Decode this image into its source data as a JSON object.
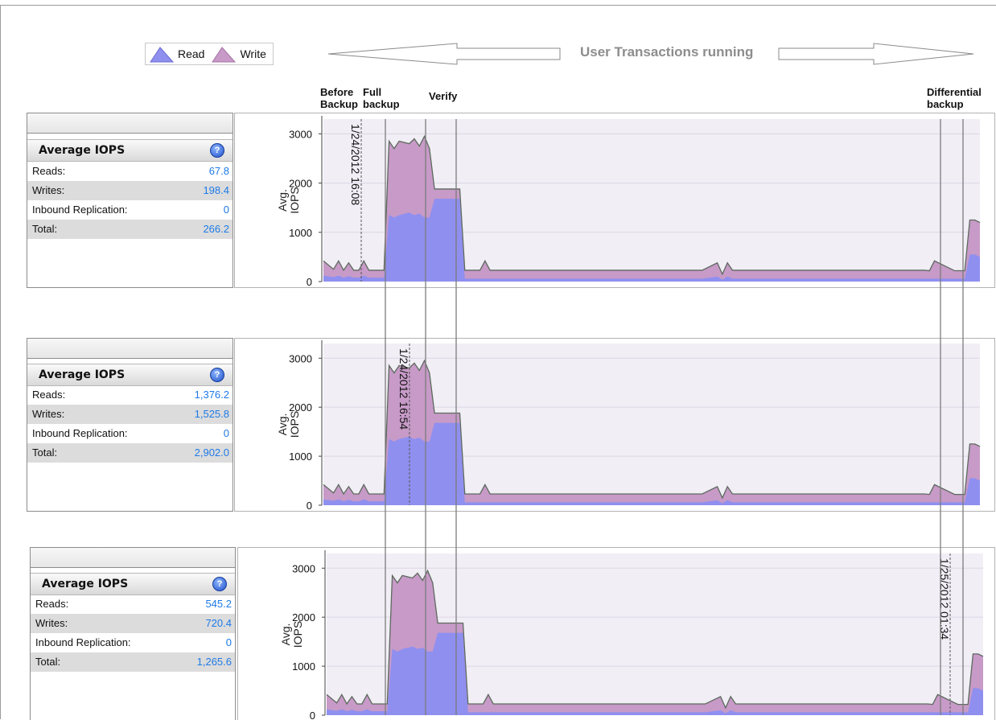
{
  "legend": {
    "items": [
      {
        "label": "Read",
        "color": "#8f8ff0"
      },
      {
        "label": "Write",
        "color": "#c79ac7"
      }
    ]
  },
  "banner": {
    "text": "User Transactions running"
  },
  "phases": [
    {
      "id": "before",
      "label": "Before\nBackup"
    },
    {
      "id": "full",
      "label": "Full\nbackup"
    },
    {
      "id": "verify",
      "label": "Verify"
    },
    {
      "id": "diff",
      "label": "Differential\nbackup"
    }
  ],
  "panels": [
    {
      "title": "Average IOPS",
      "rows": [
        {
          "label": "Reads:",
          "value": "67.8"
        },
        {
          "label": "Writes:",
          "value": "198.4"
        },
        {
          "label": "Inbound Replication:",
          "value": "0"
        },
        {
          "label": "Total:",
          "value": "266.2"
        }
      ]
    },
    {
      "title": "Average IOPS",
      "rows": [
        {
          "label": "Reads:",
          "value": "1,376.2"
        },
        {
          "label": "Writes:",
          "value": "1,525.8"
        },
        {
          "label": "Inbound Replication:",
          "value": "0"
        },
        {
          "label": "Total:",
          "value": "2,902.0"
        }
      ]
    },
    {
      "title": "Average IOPS",
      "rows": [
        {
          "label": "Reads:",
          "value": "545.2"
        },
        {
          "label": "Writes:",
          "value": "720.4"
        },
        {
          "label": "Inbound Replication:",
          "value": "0"
        },
        {
          "label": "Total:",
          "value": "1,265.6"
        }
      ]
    }
  ],
  "chart_data": [
    {
      "type": "area",
      "ylabel": "Avg.\nIOPS",
      "ylim": [
        0,
        3300
      ],
      "yticks": [
        0,
        1000,
        2000,
        3000
      ],
      "cursor_label": "1/24/2012 16:08",
      "series": [
        {
          "name": "Read"
        },
        {
          "name": "Write"
        }
      ]
    },
    {
      "type": "area",
      "ylabel": "Avg.\nIOPS",
      "ylim": [
        0,
        3300
      ],
      "yticks": [
        0,
        1000,
        2000,
        3000
      ],
      "cursor_label": "1/24/2012 16:54",
      "series": [
        {
          "name": "Read"
        },
        {
          "name": "Write"
        }
      ]
    },
    {
      "type": "area",
      "ylabel": "Avg.\nIOPS",
      "ylim": [
        0,
        3300
      ],
      "yticks": [
        0,
        1000,
        2000,
        3000
      ],
      "cursor_label": "1/25/2012 01:34",
      "series": [
        {
          "name": "Read"
        },
        {
          "name": "Write"
        }
      ]
    }
  ],
  "profile": {
    "x": [
      0,
      2,
      3,
      4,
      5,
      6,
      7,
      8,
      9,
      10,
      11,
      12,
      13,
      14,
      15,
      17,
      18,
      19,
      20,
      21,
      22,
      23,
      24,
      25,
      26,
      27,
      28,
      29,
      30,
      31,
      32,
      33,
      35,
      36,
      37,
      38,
      39,
      40,
      45,
      50,
      55,
      60,
      65,
      70,
      75,
      78,
      79,
      80,
      81,
      85,
      90,
      95,
      100,
      105,
      110,
      115,
      119,
      120,
      121,
      125,
      127,
      128,
      129,
      130
    ],
    "total": [
      420,
      250,
      420,
      230,
      380,
      230,
      230,
      420,
      230,
      230,
      230,
      230,
      2850,
      2700,
      2850,
      2800,
      2900,
      2750,
      2950,
      2700,
      1880,
      1880,
      1880,
      1880,
      1880,
      1880,
      230,
      230,
      230,
      230,
      420,
      230,
      230,
      230,
      230,
      230,
      230,
      230,
      230,
      230,
      230,
      230,
      230,
      230,
      230,
      380,
      150,
      380,
      230,
      230,
      230,
      230,
      230,
      230,
      230,
      230,
      230,
      220,
      420,
      220,
      220,
      1250,
      1250,
      1200
    ],
    "read": [
      120,
      90,
      120,
      80,
      110,
      80,
      80,
      120,
      80,
      80,
      80,
      80,
      1350,
      1300,
      1350,
      1400,
      1350,
      1380,
      1300,
      1300,
      1680,
      1680,
      1680,
      1680,
      1680,
      1680,
      60,
      60,
      60,
      60,
      60,
      60,
      60,
      60,
      60,
      60,
      60,
      60,
      60,
      60,
      60,
      60,
      60,
      60,
      60,
      100,
      40,
      100,
      60,
      60,
      60,
      60,
      60,
      60,
      60,
      60,
      60,
      60,
      60,
      60,
      60,
      550,
      550,
      500
    ]
  }
}
